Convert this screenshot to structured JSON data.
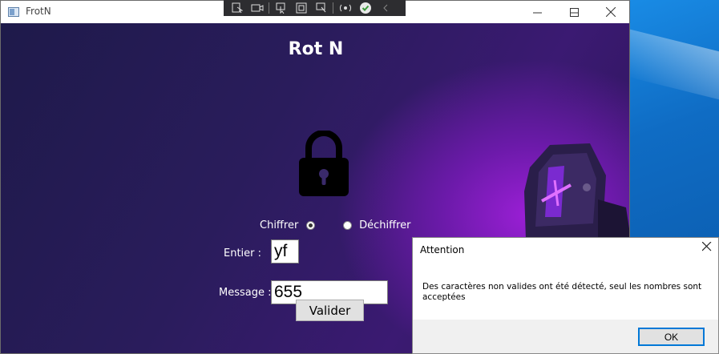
{
  "window": {
    "title": "FrotN",
    "minimize_icon": "minimize-icon",
    "maximize_icon": "maximize-icon",
    "close_icon": "close-icon"
  },
  "debug_toolbar": {
    "icons": [
      "select-element-icon",
      "video-icon",
      "pointer-icon",
      "layout-adorner-icon",
      "track-focus-icon",
      "hot-reload-icon",
      "check-circle-icon",
      "collapse-chevron-icon"
    ]
  },
  "app": {
    "heading": "Rot N",
    "lock_icon": "lock-icon",
    "mascot_icon": "ninja-mascot-icon",
    "radio_encrypt_label": "Chiffrer",
    "radio_decrypt_label": "Déchiffrer",
    "radio_selected": "Chiffrer",
    "integer_label": "Entier :",
    "integer_value": "yf",
    "message_label": "Message :",
    "message_value": "655",
    "submit_label": "Valider"
  },
  "dialog": {
    "title": "Attention",
    "message": "Des caractères non valides ont été détecté, seul les nombres sont acceptées",
    "ok_label": "OK"
  },
  "colors": {
    "accent_purple": "#9b1fd6",
    "background_dark": "#1e1a4a",
    "desktop_blue": "#0c77d6",
    "dialog_focus": "#0078d7"
  }
}
